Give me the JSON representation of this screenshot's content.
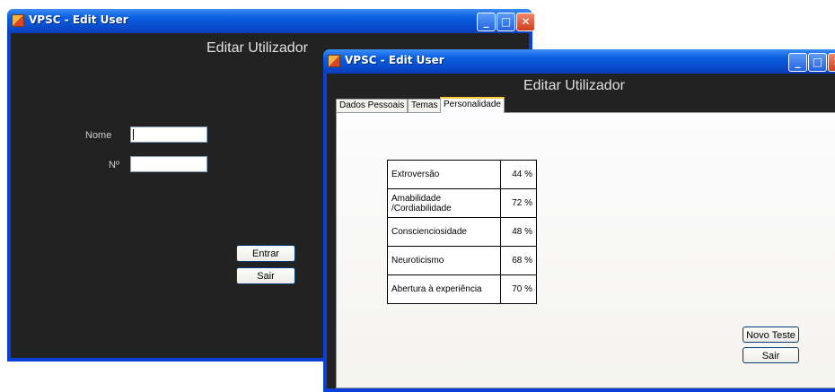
{
  "back_window": {
    "title": "VPSC - Edit User",
    "heading": "Editar Utilizador",
    "name_label": "Nome",
    "number_label": "Nº",
    "name_value": "",
    "number_value": "",
    "enter_button": "Entrar",
    "exit_button": "Sair"
  },
  "front_window": {
    "title": "VPSC - Edit User",
    "heading": "Editar Utilizador",
    "tabs": [
      {
        "label": "Dados Pessoais",
        "active": false
      },
      {
        "label": "Temas",
        "active": false
      },
      {
        "label": "Personalidade",
        "active": true
      }
    ],
    "traits": [
      {
        "name": "Extroversão",
        "value": "44 %"
      },
      {
        "name": "Amabilidade /Cordiabilidade",
        "value": "72 %"
      },
      {
        "name": "Conscienciosidade",
        "value": "48 %"
      },
      {
        "name": "Neuroticismo",
        "value": "68 %"
      },
      {
        "name": "Abertura à experiência",
        "value": "70 %"
      }
    ],
    "new_test_button": "Novo Teste",
    "exit_button": "Sair"
  },
  "caption_buttons": {
    "minimize": "_",
    "maximize": "□",
    "close": "✕"
  },
  "colors": {
    "titlebar": "#0a5fe0",
    "client_dark": "#222222",
    "tab_highlight": "#ffc83c"
  }
}
